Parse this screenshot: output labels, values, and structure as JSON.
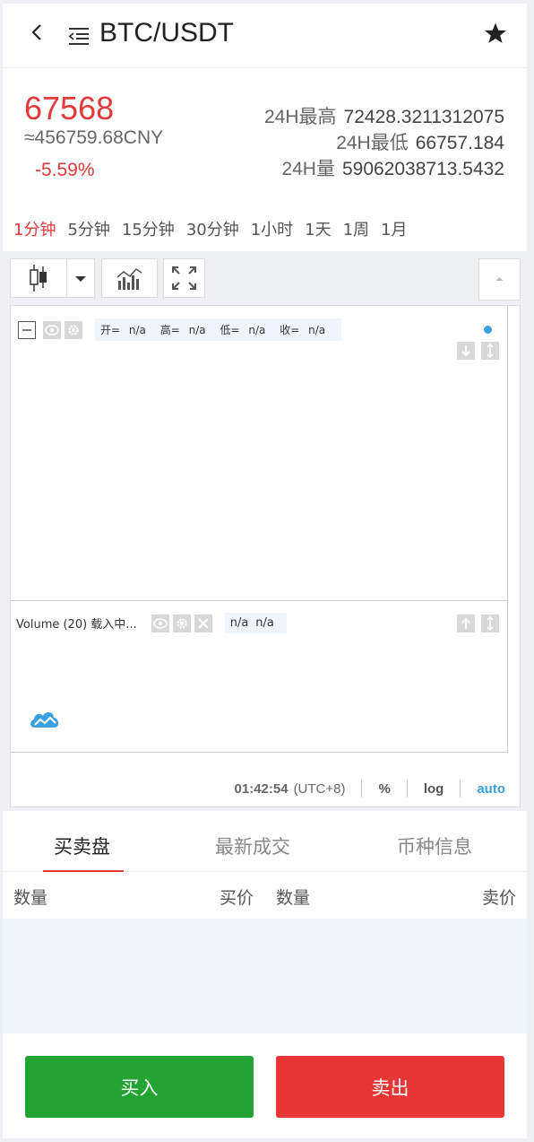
{
  "header": {
    "title": "BTC/USDT"
  },
  "ticker": {
    "price": "67568",
    "cny": "≈456759.68CNY",
    "change": "-5.59%",
    "stats": [
      {
        "label": "24H最高",
        "value": "72428.3211312075"
      },
      {
        "label": "24H最低",
        "value": "66757.184"
      },
      {
        "label": "24H量",
        "value": "59062038713.5432"
      }
    ]
  },
  "intervals": [
    "1分钟",
    "5分钟",
    "15分钟",
    "30分钟",
    "1小时",
    "1天",
    "1周",
    "1月"
  ],
  "active_interval": "1分钟",
  "chart": {
    "ohlc": [
      {
        "label": "开=",
        "value": "n/a"
      },
      {
        "label": "高=",
        "value": "n/a"
      },
      {
        "label": "低=",
        "value": "n/a"
      },
      {
        "label": "收=",
        "value": "n/a"
      }
    ],
    "volume_label": "Volume (20) 载入中...",
    "volume_values": [
      "n/a",
      "n/a"
    ],
    "time": "01:42:54",
    "timezone": "(UTC+8)",
    "percent": "%",
    "log": "log",
    "auto": "auto"
  },
  "tabs": [
    "买卖盘",
    "最新成交",
    "币种信息"
  ],
  "orderbook": {
    "col_qty_buy": "数量",
    "col_buy_price": "买价",
    "col_qty_sell": "数量",
    "col_sell_price": "卖价"
  },
  "actions": {
    "buy": "买入",
    "sell": "卖出"
  },
  "colors": {
    "up": "#21a431",
    "down": "#e83535",
    "accent": "#3aa0e0"
  }
}
